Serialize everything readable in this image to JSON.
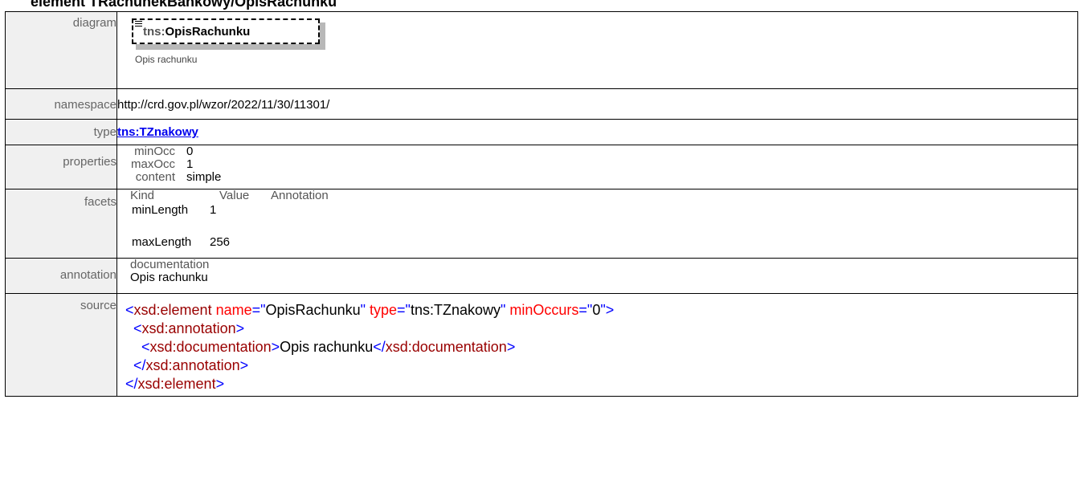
{
  "heading": "element TRachunekBankowy/OpisRachunku",
  "labels": {
    "diagram": "diagram",
    "namespace": "namespace",
    "type": "type",
    "properties": "properties",
    "facets": "facets",
    "annotation": "annotation",
    "source": "source"
  },
  "diagram": {
    "prefix": "tns:",
    "name": "OpisRachunku",
    "caption": "Opis rachunku",
    "icon": "element-lines-icon"
  },
  "namespace": "http://crd.gov.pl/wzor/2022/11/30/11301/",
  "type": {
    "link_text": "tns:TZnakowy"
  },
  "properties": [
    {
      "key": "minOcc",
      "value": "0"
    },
    {
      "key": "maxOcc",
      "value": "1"
    },
    {
      "key": "content",
      "value": "simple"
    }
  ],
  "facets": {
    "headers": [
      "Kind",
      "Value",
      "Annotation"
    ],
    "rows": [
      {
        "kind": "minLength",
        "value": "1"
      },
      {
        "kind": "maxLength",
        "value": "256"
      }
    ]
  },
  "annotation": {
    "title": "documentation",
    "text": "Opis rachunku"
  },
  "source": {
    "l1_open": "<",
    "l1_tag": "xsd:element",
    "l1_attr1": "name",
    "l1_eq1": "=\"",
    "l1_val1": "OpisRachunku",
    "l1_q1": "\"",
    "l1_attr2": "type",
    "l1_eq2": "=\"",
    "l1_val2": "tns:TZnakowy",
    "l1_q2": "\"",
    "l1_attr3": "minOccurs",
    "l1_eq3": "=\"",
    "l1_val3": "0",
    "l1_close": "\">",
    "l2_indent": "  ",
    "l2_open": "<",
    "l2_tag": "xsd:annotation",
    "l2_close": ">",
    "l3_indent": "    ",
    "l3_open": "<",
    "l3_tag": "xsd:documentation",
    "l3_close": ">",
    "l3_text": "Opis rachunku",
    "l3_open2": "</",
    "l3_tag2": "xsd:documentation",
    "l3_close2": ">",
    "l4_indent": "  ",
    "l4_open": "</",
    "l4_tag": "xsd:annotation",
    "l4_close": ">",
    "l5_open": "</",
    "l5_tag": "xsd:element",
    "l5_close": ">"
  },
  "colors": {
    "label_bg": "#f0f0f0",
    "link": "#0000ee",
    "xml_tag": "#990000",
    "xml_bracket": "#0000ff",
    "xml_attr": "#ff0000"
  }
}
